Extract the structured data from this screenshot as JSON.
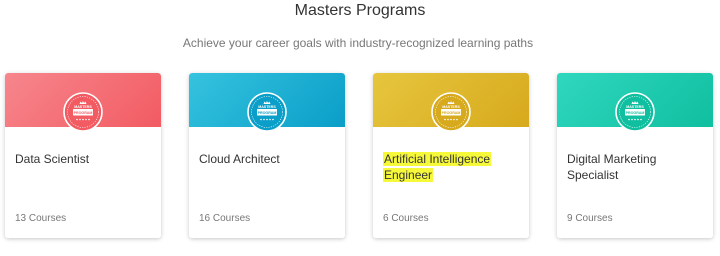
{
  "section": {
    "title": "Masters Programs",
    "subtitle": "Achieve your career goals with industry-recognized learning paths"
  },
  "badge": {
    "top_text": "MASTERS",
    "bottom_text": "PROGRAM",
    "icon": "masters-program-badge-icon"
  },
  "programs": [
    {
      "name": "Data Scientist",
      "courses": "13 Courses",
      "header_from": "#f7868d",
      "header_to": "#f25b62",
      "highlighted": false
    },
    {
      "name": "Cloud Architect",
      "courses": "16 Courses",
      "header_from": "#35c3de",
      "header_to": "#0a9ec8",
      "highlighted": false
    },
    {
      "name": "Artificial Intelligence Engineer",
      "courses": "6 Courses",
      "header_from": "#e6c63e",
      "header_to": "#d7a91c",
      "highlighted": true
    },
    {
      "name": "Digital Marketing Specialist",
      "courses": "9 Courses",
      "header_from": "#2fd7bf",
      "header_to": "#10bf9f",
      "highlighted": false
    }
  ]
}
